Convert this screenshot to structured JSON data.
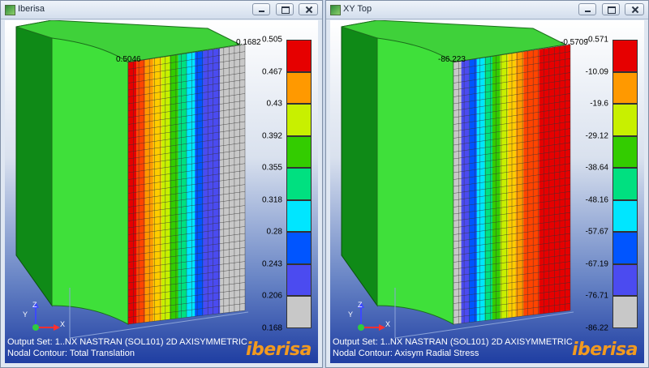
{
  "windows": [
    {
      "title": "Iberisa",
      "output_set": "Output Set: 1..NX NASTRAN (SOL101) 2D AXISYMMETRIC",
      "contour": "Nodal Contour: Total Translation",
      "logo": "iberisa",
      "label_inner": "0.5046",
      "label_outer": "0.1682",
      "legend": [
        "0.505",
        "0.467",
        "0.43",
        "0.392",
        "0.355",
        "0.318",
        "0.28",
        "0.243",
        "0.206",
        "0.168"
      ],
      "legend_colors": [
        "#e60000",
        "#ff9900",
        "#c8f000",
        "#33cc00",
        "#00e080",
        "#00e6ff",
        "#0055ff",
        "#4b4bf0",
        "#c8c8c8"
      ],
      "mesh_colors": [
        "#e60000",
        "#ff4400",
        "#ff9900",
        "#ffcc00",
        "#c8f000",
        "#33cc00",
        "#00e080",
        "#00e6ff",
        "#0055ff",
        "#4b4bf0",
        "#c8c8c8"
      ],
      "mesh_strip_widths": [
        1,
        1,
        1,
        1,
        1,
        1,
        1,
        1,
        1,
        2,
        3
      ],
      "triad": {
        "y": "Y",
        "z": "Z",
        "x": "X"
      }
    },
    {
      "title": "XY Top",
      "output_set": "Output Set: 1..NX NASTRAN (SOL101) 2D AXISYMMETRIC",
      "contour": "Nodal Contour: Axisym Radial Stress",
      "logo": "iberisa",
      "label_inner": "-86.223",
      "label_outer": "-0.5709",
      "legend": [
        "-0.571",
        "-10.09",
        "-19.6",
        "-29.12",
        "-38.64",
        "-48.16",
        "-57.67",
        "-67.19",
        "-76.71",
        "-86.22"
      ],
      "legend_colors": [
        "#e60000",
        "#ff9900",
        "#c8f000",
        "#33cc00",
        "#00e080",
        "#00e6ff",
        "#0055ff",
        "#4b4bf0",
        "#c8c8c8"
      ],
      "mesh_colors": [
        "#c8c8c8",
        "#4b4bf0",
        "#0055ff",
        "#00e6ff",
        "#00e080",
        "#33cc00",
        "#c8f000",
        "#ffcc00",
        "#ff9900",
        "#ff4400",
        "#e60000"
      ],
      "mesh_strip_widths": [
        1,
        1,
        1,
        1,
        1,
        1,
        1,
        1,
        1,
        2,
        4
      ],
      "triad": {
        "y": "Y",
        "z": "Z",
        "x": "X"
      }
    }
  ]
}
